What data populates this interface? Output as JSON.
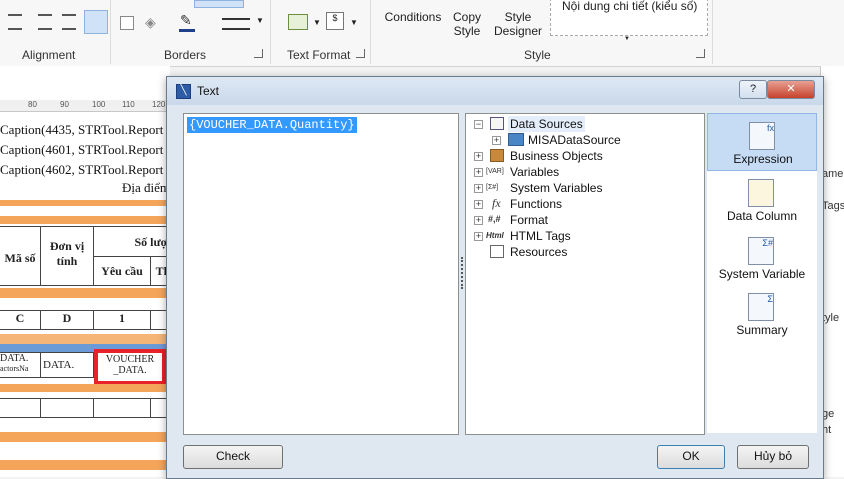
{
  "ribbon": {
    "groups": {
      "alignment": "Alignment",
      "borders": "Borders",
      "text_format": "Text Format",
      "style": "Style"
    },
    "buttons": {
      "conditions": "Conditions",
      "copy_style_1": "Copy",
      "copy_style_2": "Style",
      "style_designer_1": "Style",
      "style_designer_2": "Designer"
    },
    "style_gallery_item": "Nội dung chi tiết (kiểu số)"
  },
  "report": {
    "ruler": [
      "80",
      "90",
      "100",
      "110",
      "120"
    ],
    "caption_lines": [
      "Caption(4435, STRTool.Report",
      "Caption(4601, STRTool.Report",
      "Caption(4602, STRTool.Report"
    ],
    "dia_diem": "Địa điểm",
    "headers": {
      "ma_so": "Mã số",
      "don_vi_1": "Đơn vị",
      "don_vi_2": "tính",
      "so_luong": "Số lượn",
      "yeu_cau": "Yêu cầu",
      "thuc": "Th"
    },
    "letters": [
      "C",
      "D",
      "1"
    ],
    "data_cells": {
      "c1_1": "DATA.",
      "c1_2": "actorsNa",
      "c2_1": "DATA.",
      "c3_1": "VOUCHER",
      "c3_2": "_DATA."
    }
  },
  "right_panel": [
    "ame",
    "Tags",
    "tyle",
    "ge",
    "ht"
  ],
  "dialog": {
    "title": "Text",
    "help": "?",
    "expression_text": "{VOUCHER_DATA.Quantity}",
    "tree": [
      "Data Sources",
      "MISADataSource",
      "Business Objects",
      "Variables",
      "System Variables",
      "Functions",
      "Format",
      "HTML Tags",
      "Resources"
    ],
    "tree_icons": {
      "variables": "[VAR]",
      "system_variables": "[Σ#]",
      "functions": "fx",
      "format": "#,#",
      "html": "Html"
    },
    "side_buttons": [
      "Expression",
      "Data Column",
      "System Variable",
      "Summary"
    ],
    "buttons": {
      "check": "Check",
      "ok": "OK",
      "cancel": "Hủy bỏ"
    }
  }
}
